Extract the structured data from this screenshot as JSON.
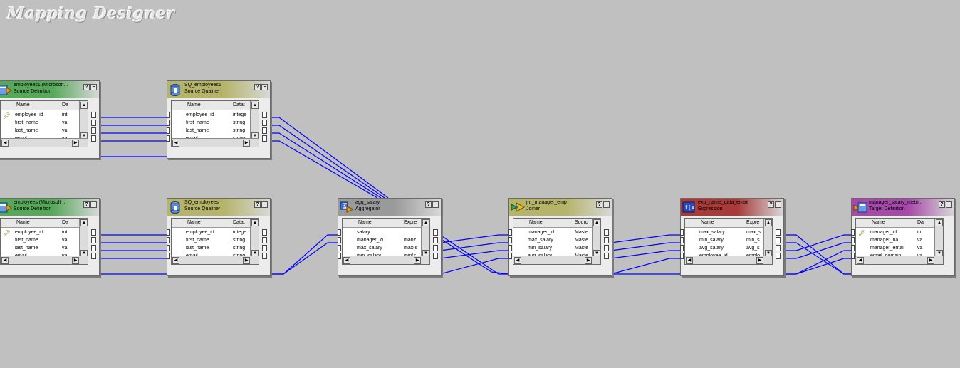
{
  "app": {
    "title": "Mapping Designer"
  },
  "transformations": [
    {
      "id": "src1",
      "name": "employees1 (Microsoft...",
      "type": "Source Definition",
      "icon": "source-definition-icon",
      "header_color": "#57a85a",
      "columns": [
        "Name",
        "Da"
      ],
      "rows": [
        {
          "name": "employee_id",
          "val": "int",
          "key": true
        },
        {
          "name": "first_name",
          "val": "va"
        },
        {
          "name": "last_name",
          "val": "va"
        },
        {
          "name": "email",
          "val": "va"
        }
      ]
    },
    {
      "id": "sq1",
      "name": "SQ_employees1",
      "type": "Source Qualifier",
      "icon": "source-qualifier-icon",
      "header_color": "#b5b46a",
      "columns": [
        "Name",
        "Datat"
      ],
      "rows": [
        {
          "name": "employee_id",
          "val": "intege"
        },
        {
          "name": "first_name",
          "val": "string"
        },
        {
          "name": "last_name",
          "val": "string"
        },
        {
          "name": "email",
          "val": "string"
        }
      ]
    },
    {
      "id": "src2",
      "name": "employees (Microsoft ...",
      "type": "Source Definition",
      "icon": "source-definition-icon",
      "header_color": "#57a85a",
      "columns": [
        "Name",
        "Da"
      ],
      "rows": [
        {
          "name": "employee_id",
          "val": "int",
          "key": true
        },
        {
          "name": "first_name",
          "val": "va"
        },
        {
          "name": "last_name",
          "val": "va"
        },
        {
          "name": "email",
          "val": "va"
        }
      ]
    },
    {
      "id": "sq2",
      "name": "SQ_employees",
      "type": "Source Qualifier",
      "icon": "source-qualifier-icon",
      "header_color": "#b5b46a",
      "columns": [
        "Name",
        "Datat"
      ],
      "rows": [
        {
          "name": "employee_id",
          "val": "intege"
        },
        {
          "name": "first_name",
          "val": "string"
        },
        {
          "name": "last_name",
          "val": "string"
        },
        {
          "name": "email",
          "val": "string"
        }
      ]
    },
    {
      "id": "agg",
      "name": "agg_salary",
      "type": "Aggregator",
      "icon": "aggregator-icon",
      "header_color": "#9a9a9a",
      "columns": [
        "Name",
        "Expre"
      ],
      "rows": [
        {
          "name": "salary",
          "val": ""
        },
        {
          "name": "manager_id",
          "val": "manz"
        },
        {
          "name": "max_salary",
          "val": "max(s"
        },
        {
          "name": "min_salary",
          "val": "min(s"
        }
      ]
    },
    {
      "id": "jnr",
      "name": "jnr_manager_emp",
      "type": "Joiner",
      "icon": "joiner-icon",
      "header_color": "#b5b46a",
      "columns": [
        "Name",
        "Sourc"
      ],
      "rows": [
        {
          "name": "manager_id",
          "val": "Maste"
        },
        {
          "name": "max_salary",
          "val": "Maste"
        },
        {
          "name": "min_salary",
          "val": "Maste"
        },
        {
          "name": "avg_salary",
          "val": "Maste"
        }
      ]
    },
    {
      "id": "exp",
      "name": "exp_name_data_email",
      "type": "Expression",
      "icon": "expression-icon",
      "header_color": "#a83a3a",
      "columns": [
        "Name",
        "Expre"
      ],
      "rows": [
        {
          "name": "max_salary",
          "val": "max_s"
        },
        {
          "name": "min_salary",
          "val": "min_s"
        },
        {
          "name": "avg_salary",
          "val": "avg_s"
        },
        {
          "name": "employee_id",
          "val": "emplo"
        }
      ]
    },
    {
      "id": "tgt",
      "name": "manager_salary_metri...",
      "type": "Target Definition",
      "icon": "target-definition-icon",
      "header_color": "#a54aa8",
      "columns": [
        "Name",
        "Da"
      ],
      "rows": [
        {
          "name": "manager_id",
          "val": "int",
          "key": true
        },
        {
          "name": "manager_na...",
          "val": "va"
        },
        {
          "name": "manager_email",
          "val": "va"
        },
        {
          "name": "email_domain",
          "val": "va"
        }
      ]
    }
  ]
}
